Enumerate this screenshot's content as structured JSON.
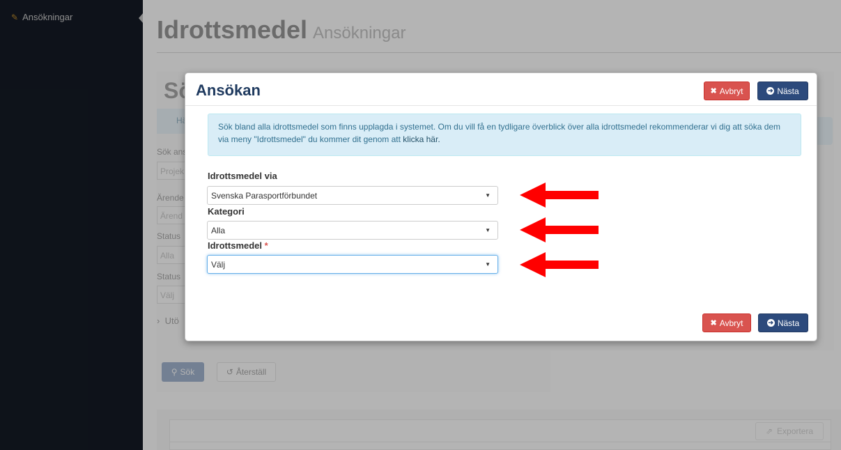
{
  "sidebar": {
    "items": [
      {
        "label": "Ansökningar",
        "icon": "pencil-icon"
      }
    ]
  },
  "header": {
    "title": "Idrottsmedel",
    "subtitle": "Ansökningar"
  },
  "background": {
    "title": "Sö",
    "info_text": "Här s",
    "labels": [
      "Sök ans",
      "Ärende",
      "Status",
      "Status"
    ],
    "inputs": [
      "Projek",
      "Ärend",
      "Alla",
      "Välj"
    ],
    "expand_label": "Utö",
    "search_button": "Sök",
    "reset_button": "Återställ",
    "export_button": "Exportera"
  },
  "modal": {
    "title": "Ansökan",
    "cancel_label": "Avbryt",
    "next_label": "Nästa",
    "alert_text": "Sök bland alla idrottsmedel som finns upplagda i systemet. Om du vill få en tydligare överblick över alla idrottsmedel rekommenderar vi dig att söka dem via meny \"Idrottsmedel\" du kommer dit genom att ",
    "alert_link": "klicka här.",
    "fields": [
      {
        "label": "Idrottsmedel via",
        "value": "Svenska Parasportförbundet",
        "required": false
      },
      {
        "label": "Kategori",
        "value": "Alla",
        "required": false
      },
      {
        "label": "Idrottsmedel",
        "value": "Välj",
        "required": true
      }
    ]
  },
  "colors": {
    "sidebar": "#1a2230",
    "accent": "#2c4a7c",
    "danger": "#d9534f",
    "arrow": "#ff0000",
    "info": "#d9edf7"
  }
}
